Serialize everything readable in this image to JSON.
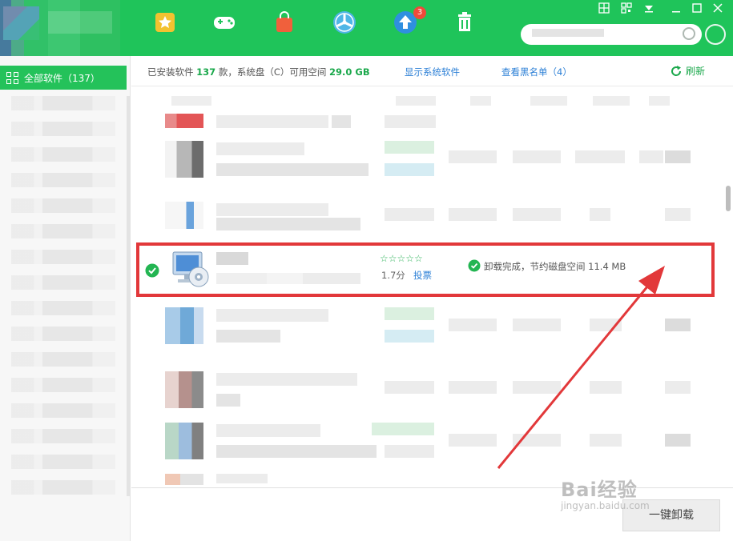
{
  "sidebar": {
    "active_label": "全部软件（137）"
  },
  "info_bar": {
    "installed_prefix": "已安装软件",
    "installed_count": "137",
    "installed_mid": "款，系统盘（C）可用空间",
    "free_space": "29.0 GB",
    "show_system_link": "显示系统软件",
    "blacklist_link": "查看黑名单（4）",
    "refresh_label": "刷新"
  },
  "focused_item": {
    "stars": "☆☆☆☆☆",
    "score": "1.7分",
    "vote_label": "投票",
    "status_text": "卸载完成，节约磁盘空间 11.4 MB"
  },
  "title_bar": {
    "update_badge": "3"
  },
  "bottom": {
    "uninstall_button": "一键卸载"
  },
  "watermark": {
    "main": "Bai经验",
    "sub": "jingyan.baidu.com"
  },
  "colors": {
    "brand_green": "#1fc45a",
    "highlight_red": "#e2383a",
    "link_blue": "#2b7fd6"
  },
  "icons": [
    "star-icon",
    "gamepad-icon",
    "shopping-bag-icon",
    "fan-icon",
    "upgrade-arrow-icon",
    "trash-icon",
    "check-icon",
    "computer-disc-icon",
    "refresh-icon",
    "grid-icon"
  ]
}
